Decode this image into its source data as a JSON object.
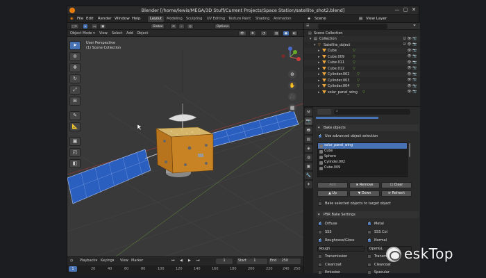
{
  "window": {
    "title": "Blender [/home/lewis/MEGA/3D Stuff/Current Projects/Space Station/satellite_shot2.blend]",
    "controls": [
      "—",
      "▢",
      "✕"
    ]
  },
  "menubar": {
    "menus": [
      "File",
      "Edit",
      "Render",
      "Window",
      "Help"
    ],
    "workspaces": [
      "Layout",
      "Modeling",
      "Sculpting",
      "UV Editing",
      "Texture Paint",
      "Shading",
      "Animation"
    ],
    "active_workspace": "Layout",
    "scene": "Scene",
    "view_layer": "View Layer"
  },
  "viewport_header": {
    "mode": "Object Mode",
    "menus": [
      "View",
      "Select",
      "Add",
      "Object"
    ],
    "transform": "Global",
    "options": "Options"
  },
  "viewport": {
    "view_name": "User Perspective",
    "collection": "(1) Scene Collection"
  },
  "outliner": {
    "items": [
      {
        "label": "Scene Collection",
        "level": 0,
        "icon": "collection-icon"
      },
      {
        "label": "Collection",
        "level": 1,
        "icon": "collection-icon"
      },
      {
        "label": "Satellite_object",
        "level": 2,
        "icon": "object-icon"
      },
      {
        "label": "Cube",
        "level": 3,
        "icon": "mesh-icon"
      },
      {
        "label": "Cube.009",
        "level": 3,
        "icon": "mesh-icon"
      },
      {
        "label": "Cube.011",
        "level": 3,
        "icon": "mesh-icon"
      },
      {
        "label": "Cube.012",
        "level": 3,
        "icon": "mesh-icon"
      },
      {
        "label": "Cylinder.002",
        "level": 3,
        "icon": "mesh-icon"
      },
      {
        "label": "Cylinder.003",
        "level": 3,
        "icon": "mesh-icon"
      },
      {
        "label": "Cylinder.004",
        "level": 3,
        "icon": "mesh-icon"
      },
      {
        "label": "solar_panel_wing",
        "level": 3,
        "icon": "mesh-icon"
      }
    ]
  },
  "properties": {
    "panel_title": "Bake objects",
    "use_advanced": "Use advanced object selection",
    "object_list": [
      "solar_panel_wing",
      "Cube",
      "Sphere",
      "Cylinder.002",
      "Cube.009"
    ],
    "selected_index": 0,
    "buttons": {
      "add": "Add",
      "remove": "Remove",
      "clear": "Clear",
      "up": "Up",
      "down": "Down",
      "refresh": "Refresh"
    },
    "bake_to_target": "Bake selected objects to target object",
    "pbr_title": "PBR Bake Settings",
    "pbr_checks": [
      {
        "label": "Diffuse",
        "on": true
      },
      {
        "label": "Metal",
        "on": true
      },
      {
        "label": "SSS",
        "on": false
      },
      {
        "label": "SSS Col",
        "on": false
      },
      {
        "label": "Roughness/Gloss",
        "on": true
      },
      {
        "label": "Normal",
        "on": true
      }
    ],
    "rough_select": "Rough",
    "normal_select": "OpenGL",
    "extra_checks": [
      "Transmission",
      "Transmission",
      "Clearcoat",
      "Clearcoat",
      "Emission",
      "Specular"
    ]
  },
  "timeline": {
    "menus": [
      "Playback",
      "Keying",
      "View",
      "Marker"
    ],
    "current_frame": "1",
    "start_label": "Start",
    "start": "1",
    "end_label": "End",
    "end": "250",
    "frame_marks": [
      "1",
      "20",
      "40",
      "60",
      "80",
      "100",
      "120",
      "140",
      "160",
      "180",
      "200",
      "220",
      "240",
      "250"
    ]
  },
  "watermark": {
    "text": "eskTop"
  },
  "colors": {
    "accent": "#4772b3",
    "orange": "#e87d0d",
    "panel_blue": "#2a5fc0"
  }
}
